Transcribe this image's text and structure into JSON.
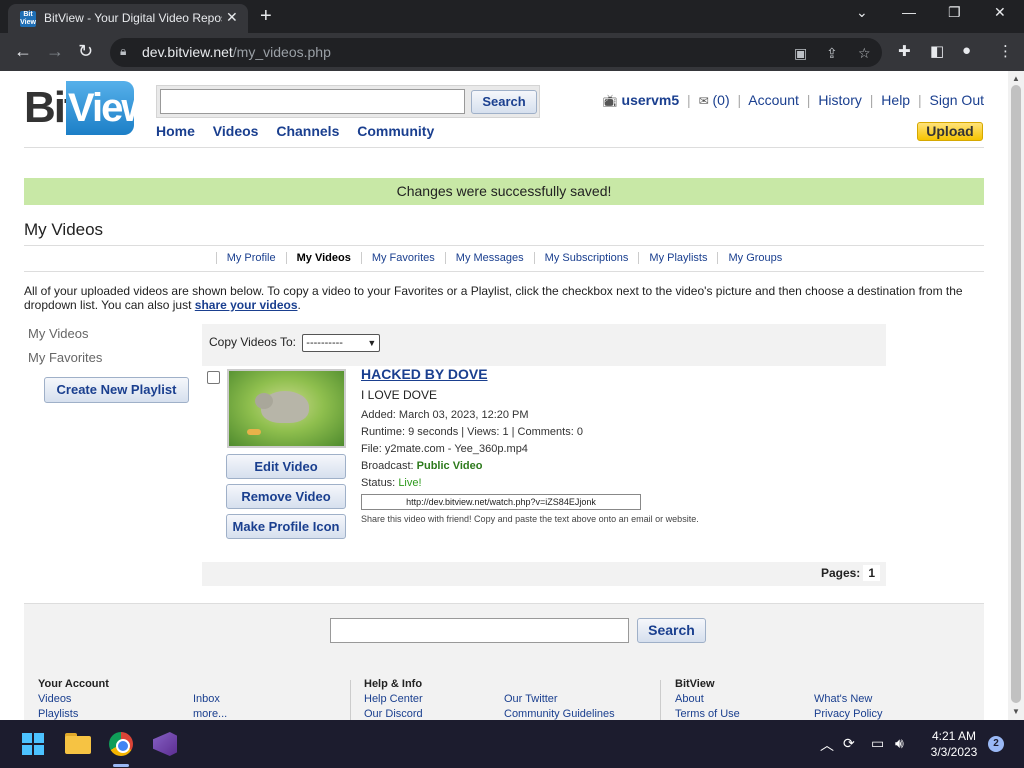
{
  "browser": {
    "tab_title": "BitView - Your Digital Video Repository",
    "favicon_text": "Bit View",
    "url_host": "dev.bitview.net",
    "url_path": "/my_videos.php"
  },
  "site": {
    "logo_bit": "Bit",
    "logo_view": "View",
    "search_button": "Search",
    "nav": [
      "Home",
      "Videos",
      "Channels",
      "Community"
    ],
    "user": {
      "username": "uservm5",
      "messages": "(0)",
      "links": [
        "Account",
        "History",
        "Help",
        "Sign Out"
      ],
      "upload": "Upload"
    }
  },
  "notice": "Changes were successfully saved!",
  "page_title": "My Videos",
  "subnav": [
    "My Profile",
    "My Videos",
    "My Favorites",
    "My Messages",
    "My Subscriptions",
    "My Playlists",
    "My Groups"
  ],
  "intro": {
    "text": "All of your uploaded videos are shown below. To copy a video to your Favorites or a Playlist, click the checkbox next to the video's picture and then choose a destination from the dropdown list. You can also just ",
    "link": "share your videos",
    "end": "."
  },
  "sidebar": {
    "items": [
      "My Videos",
      "My Favorites"
    ],
    "create_playlist": "Create New Playlist"
  },
  "copy_bar": {
    "label": "Copy Videos To:",
    "selected": "----------"
  },
  "video": {
    "title": "HACKED BY DOVE",
    "description": "I LOVE DOVE",
    "added": "Added: March 03, 2023, 12:20 PM",
    "runtime": "Runtime: 9 seconds | Views: 1 | Comments: 0",
    "file": "File: y2mate.com - Yee_360p.mp4",
    "broadcast_label": "Broadcast:",
    "broadcast_value": "Public Video",
    "status_label": "Status:",
    "status_value": "Live!",
    "share_url": "http://dev.bitview.net/watch.php?v=iZS84EJjonk",
    "share_text": "Share this video with friend! Copy and paste the text above onto an email or website.",
    "buttons": [
      "Edit Video",
      "Remove Video",
      "Make Profile Icon"
    ]
  },
  "pagination": {
    "label": "Pages:",
    "current": "1"
  },
  "footer": {
    "search_button": "Search",
    "columns": [
      {
        "heading": "Your Account",
        "links": [
          "Videos",
          "Playlists"
        ]
      },
      {
        "heading": "",
        "links": [
          "Inbox",
          "more..."
        ]
      },
      {
        "heading": "Help & Info",
        "links": [
          "Help Center",
          "Our Discord"
        ]
      },
      {
        "heading": "",
        "links": [
          "Our Twitter",
          "Community Guidelines"
        ]
      },
      {
        "heading": "BitView",
        "links": [
          "About",
          "Terms of Use"
        ]
      },
      {
        "heading": "",
        "links": [
          "What's New",
          "Privacy Policy"
        ]
      }
    ]
  },
  "taskbar": {
    "time": "4:21 AM",
    "date": "3/3/2023",
    "notifications": "2"
  },
  "colors": {
    "link_blue": "#1a3f8f",
    "notice_green": "#c8e8a6",
    "upload_yellow": "#f5c400",
    "logo_blue": "#1c7fc7"
  }
}
